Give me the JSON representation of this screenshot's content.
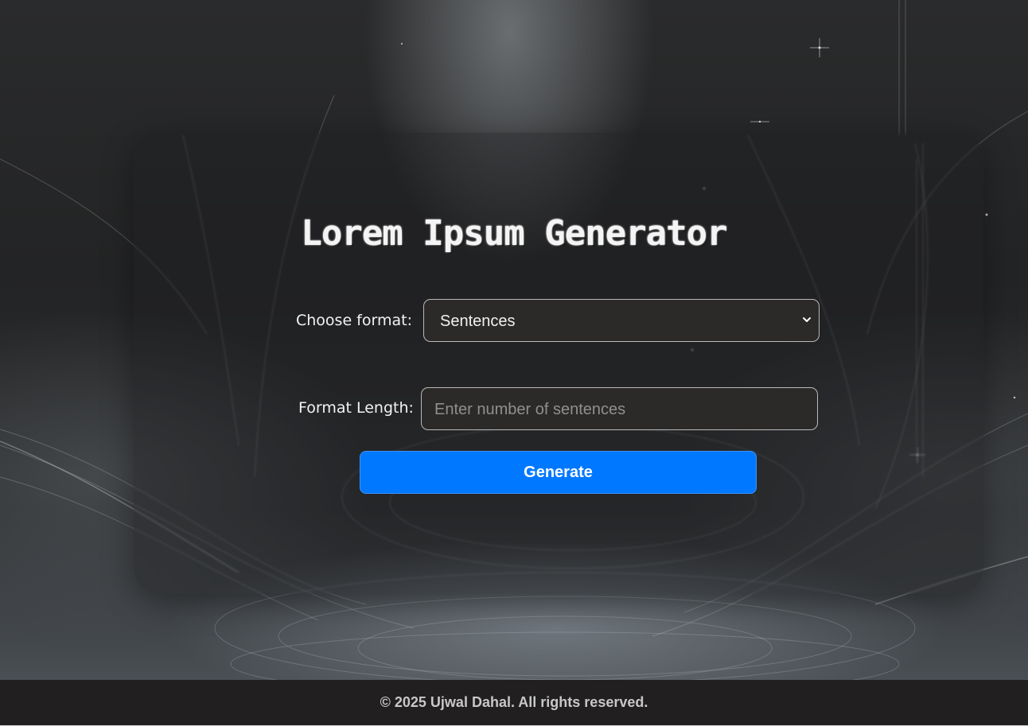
{
  "title": "Lorem Ipsum Generator",
  "form": {
    "format_label": "Choose format:",
    "format_selected": "Sentences",
    "length_label": "Format Length:",
    "length_placeholder": "Enter number of sentences",
    "generate_label": "Generate"
  },
  "footer": {
    "text": "© 2025 Ujwal Dahal. All rights reserved."
  },
  "colors": {
    "accent": "#0078ff",
    "field_background": "#2c2a28",
    "footer_background": "#211f1f"
  },
  "icons": {
    "select_arrow": "chevron-down-icon"
  }
}
